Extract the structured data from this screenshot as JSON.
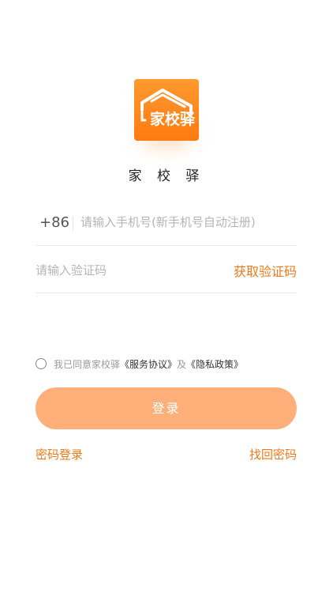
{
  "logo": {
    "text": "家校驿",
    "icon": "house-roof-icon",
    "colors": {
      "top": "#ff9a2e",
      "bottom": "#ff7a12"
    }
  },
  "app_name": "家 校 驿",
  "phone": {
    "country_code": "+86",
    "placeholder": "请输入手机号(新手机号自动注册)",
    "value": ""
  },
  "verify": {
    "placeholder": "请输入验证码",
    "value": "",
    "get_code_label": "获取验证码"
  },
  "agreement": {
    "checked": false,
    "prefix": "我已同意家校驿",
    "service_link": "《服务协议》",
    "conjunction": "及",
    "privacy_link": "《隐私政策》"
  },
  "login_button": {
    "label": "登录"
  },
  "links": {
    "password_login": "密码登录",
    "find_password": "找回密码"
  },
  "colors": {
    "accent": "#f07a1a",
    "button": "#ffb07a",
    "placeholder": "#b5b5b5"
  }
}
